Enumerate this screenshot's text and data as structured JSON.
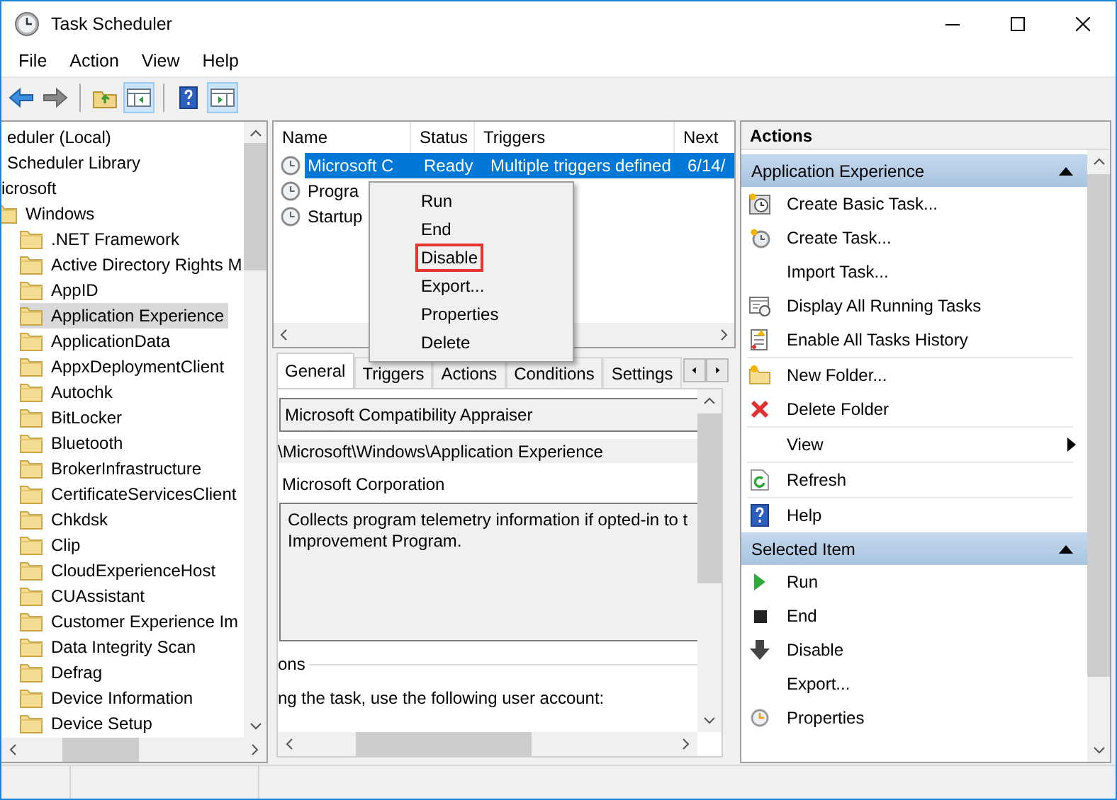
{
  "window": {
    "title": "Task Scheduler"
  },
  "menu": [
    "File",
    "Action",
    "View",
    "Help"
  ],
  "toolbar": [
    [
      {
        "kind": "back",
        "pressed": false
      },
      {
        "kind": "forward",
        "pressed": false
      }
    ],
    [
      {
        "kind": "folder",
        "pressed": false
      },
      {
        "kind": "paneleft",
        "pressed": true
      }
    ],
    [
      {
        "kind": "help",
        "pressed": false
      },
      {
        "kind": "paneright",
        "pressed": true
      }
    ]
  ],
  "tree": [
    {
      "label": "eduler (Local)",
      "selected": false,
      "children": [
        {
          "label": "Scheduler Library",
          "selected": false,
          "children": [
            {
              "label": "icrosoft",
              "selected": false,
              "children": [
                {
                  "label": "Windows",
                  "selected": false,
                  "children": [
                    {
                      "label": ".NET Framework",
                      "selected": false
                    },
                    {
                      "label": "Active Directory Rights M",
                      "selected": false
                    },
                    {
                      "label": "AppID",
                      "selected": false
                    },
                    {
                      "label": "Application Experience",
                      "selected": true
                    },
                    {
                      "label": "ApplicationData",
                      "selected": false
                    },
                    {
                      "label": "AppxDeploymentClient",
                      "selected": false
                    },
                    {
                      "label": "Autochk",
                      "selected": false
                    },
                    {
                      "label": "BitLocker",
                      "selected": false
                    },
                    {
                      "label": "Bluetooth",
                      "selected": false
                    },
                    {
                      "label": "BrokerInfrastructure",
                      "selected": false
                    },
                    {
                      "label": "CertificateServicesClient",
                      "selected": false
                    },
                    {
                      "label": "Chkdsk",
                      "selected": false
                    },
                    {
                      "label": "Clip",
                      "selected": false
                    },
                    {
                      "label": "CloudExperienceHost",
                      "selected": false
                    },
                    {
                      "label": "CUAssistant",
                      "selected": false
                    },
                    {
                      "label": "Customer Experience Im",
                      "selected": false
                    },
                    {
                      "label": "Data Integrity Scan",
                      "selected": false
                    },
                    {
                      "label": "Defrag",
                      "selected": false
                    },
                    {
                      "label": "Device Information",
                      "selected": false
                    },
                    {
                      "label": "Device Setup",
                      "selected": false
                    }
                  ]
                }
              ]
            }
          ]
        }
      ]
    }
  ],
  "task_list": {
    "columns": [
      "Name",
      "Status",
      "Triggers",
      "Next"
    ],
    "rows": [
      {
        "name": "Microsoft C",
        "status": "Ready",
        "triggers": "Multiple triggers defined",
        "next": "6/14/",
        "selected": true
      },
      {
        "name": "Progra",
        "selected": false
      },
      {
        "name": "Startup",
        "selected": false
      }
    ]
  },
  "context_menu": [
    {
      "label": "Run",
      "highlighted": false
    },
    {
      "label": "End",
      "highlighted": false
    },
    {
      "label": "Disable",
      "highlighted": true
    },
    {
      "label": "Export...",
      "highlighted": false
    },
    {
      "label": "Properties",
      "highlighted": false
    },
    {
      "label": "Delete",
      "highlighted": false
    }
  ],
  "details": {
    "tabs": [
      {
        "label": "General",
        "selected": true
      },
      {
        "label": "Triggers",
        "selected": false
      },
      {
        "label": "Actions",
        "selected": false
      },
      {
        "label": "Conditions",
        "selected": false
      },
      {
        "label": "Settings",
        "selected": false
      }
    ],
    "name": "Microsoft Compatibility Appraiser",
    "location": "\\Microsoft\\Windows\\Application Experience",
    "author": "Microsoft Corporation",
    "description": [
      "Collects program telemetry information if opted-in to t",
      "Improvement Program."
    ],
    "group_label": "ons",
    "account_label": "ng the task, use the following user account:"
  },
  "actions": {
    "title": "Actions",
    "sections": [
      {
        "title": "Application Experience",
        "expanded": true,
        "items": [
          {
            "label": "Create Basic Task...",
            "kind": "calendar",
            "separator_before": false,
            "submenu": false
          },
          {
            "label": "Create Task...",
            "kind": "clock",
            "separator_before": false,
            "submenu": false
          },
          {
            "label": "Import Task...",
            "kind": "plain",
            "separator_before": false,
            "submenu": false
          },
          {
            "label": "Display All Running Tasks",
            "kind": "window",
            "separator_before": false,
            "submenu": false
          },
          {
            "label": "Enable All Tasks History",
            "kind": "notebook",
            "separator_before": false,
            "submenu": false
          },
          {
            "label": "New Folder...",
            "kind": "folder",
            "separator_before": true,
            "submenu": false
          },
          {
            "label": "Delete Folder",
            "kind": "delete",
            "separator_before": false,
            "submenu": false
          },
          {
            "label": "View",
            "kind": "plain",
            "separator_before": true,
            "submenu": true
          },
          {
            "label": "Refresh",
            "kind": "refresh",
            "separator_before": true,
            "submenu": false
          },
          {
            "label": "Help",
            "kind": "help",
            "separator_before": true,
            "submenu": false
          }
        ]
      },
      {
        "title": "Selected Item",
        "expanded": true,
        "items": [
          {
            "label": "Run",
            "kind": "run",
            "separator_before": false,
            "submenu": false
          },
          {
            "label": "End",
            "kind": "stop",
            "separator_before": false,
            "submenu": false
          },
          {
            "label": "Disable",
            "kind": "disable",
            "separator_before": false,
            "submenu": false
          },
          {
            "label": "Export...",
            "kind": "plain",
            "separator_before": false,
            "submenu": false
          },
          {
            "label": "Properties",
            "kind": "properties",
            "separator_before": false,
            "submenu": false
          }
        ]
      }
    ]
  }
}
